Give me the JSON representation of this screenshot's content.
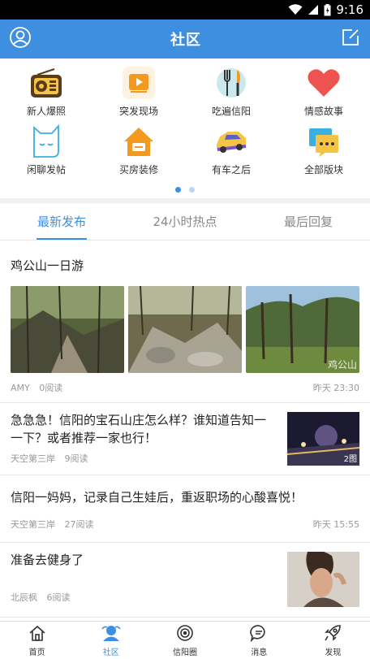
{
  "status_bar": {
    "time": "9:16"
  },
  "header": {
    "title": "社区",
    "profile_icon": "user-circle-icon",
    "compose_icon": "compose-icon"
  },
  "categories": [
    {
      "label": "新人爆照",
      "icon": "radio-icon"
    },
    {
      "label": "突发现场",
      "icon": "video-play-icon"
    },
    {
      "label": "吃遍信阳",
      "icon": "fork-knife-icon"
    },
    {
      "label": "情感故事",
      "icon": "heart-icon"
    },
    {
      "label": "闲聊发帖",
      "icon": "cat-chat-icon"
    },
    {
      "label": "买房装修",
      "icon": "house-icon"
    },
    {
      "label": "有车之后",
      "icon": "car-icon"
    },
    {
      "label": "全部版块",
      "icon": "chat-bubbles-icon"
    }
  ],
  "pager": {
    "pages": 2,
    "current": 1
  },
  "tabs": [
    {
      "label": "最新发布",
      "active": true
    },
    {
      "label": "24小时热点",
      "active": false
    },
    {
      "label": "最后回复",
      "active": false
    }
  ],
  "posts": [
    {
      "title": "鸡公山一日游",
      "author": "AMY",
      "reads": "0阅读",
      "time": "昨天 23:30",
      "image_watermark": "鸡公山"
    },
    {
      "title": "急急急！信阳的宝石山庄怎么样？谁知道告知一一下？或者推荐一家也行！",
      "author": "天空第三岸",
      "reads": "9阅读",
      "time": "",
      "badge": "2图"
    },
    {
      "title": "信阳一妈妈，记录自己生娃后，重返职场的心酸喜悦！",
      "author": "天空第三岸",
      "reads": "27阅读",
      "time": "昨天 15:55"
    },
    {
      "title": "准备去健身了",
      "author": "北辰枫",
      "reads": "6阅读",
      "time": ""
    }
  ],
  "bottom_nav": [
    {
      "label": "首页",
      "icon": "home-icon",
      "active": false
    },
    {
      "label": "社区",
      "icon": "community-icon",
      "active": true
    },
    {
      "label": "信阳圈",
      "icon": "circle-icon",
      "active": false
    },
    {
      "label": "消息",
      "icon": "message-icon",
      "active": false
    },
    {
      "label": "发现",
      "icon": "rocket-icon",
      "active": false
    }
  ],
  "colors": {
    "primary": "#3f8fe0",
    "status_bar": "#000000",
    "separator": "#f0f0f0"
  }
}
